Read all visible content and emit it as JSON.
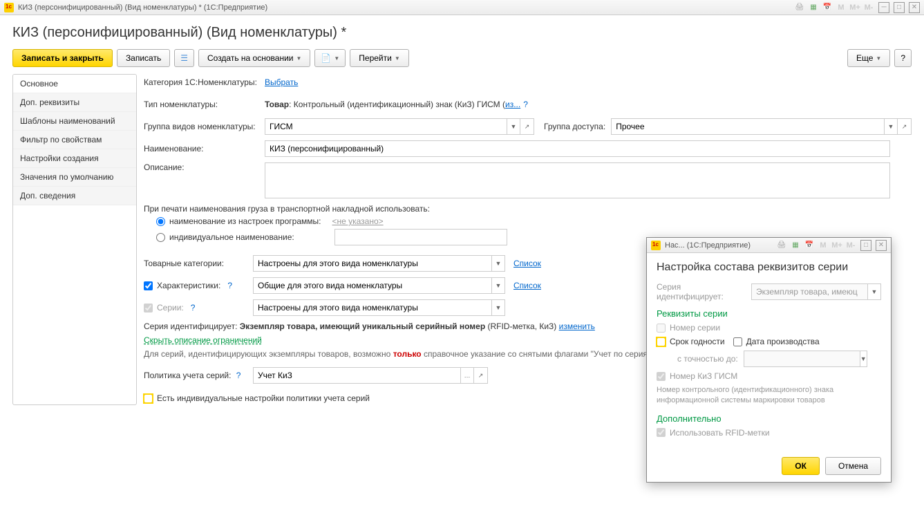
{
  "window": {
    "title": "КИЗ (персонифицированный) (Вид номенклатуры) *   (1С:Предприятие)",
    "m": "M",
    "mplus": "M+",
    "mminus": "M-"
  },
  "page_title": "КИЗ (персонифицированный) (Вид номенклатуры) *",
  "toolbar": {
    "save_close": "Записать и закрыть",
    "save": "Записать",
    "create_based": "Создать на основании",
    "goto": "Перейти",
    "more": "Еще",
    "help": "?"
  },
  "sidebar": {
    "items": [
      "Основное",
      "Доп. реквизиты",
      "Шаблоны наименований",
      "Фильтр по свойствам",
      "Настройки создания",
      "Значения по умолчанию",
      "Доп. сведения"
    ]
  },
  "form": {
    "category_label": "Категория 1С:Номенклатуры:",
    "category_link": "Выбрать",
    "type_label": "Тип номенклатуры:",
    "type_value_bold": "Товар",
    "type_value_rest": ": Контрольный (идентификационный) знак (КиЗ) ГИСМ (",
    "type_change": "из...",
    "type_paren_close": ")",
    "group_kind_label": "Группа видов номенклатуры:",
    "group_kind_value": "ГИСМ",
    "access_group_label": "Группа доступа:",
    "access_group_value": "Прочее",
    "name_label": "Наименование:",
    "name_value": "КИЗ (персонифицированный)",
    "desc_label": "Описание:",
    "desc_value": "",
    "print_label": "При печати наименования груза в транспортной накладной использовать:",
    "radio1": "наименование из настроек программы:",
    "radio1_notset": "<не указано>",
    "radio2": "индивидуальное наименование:",
    "radio2_value": "",
    "tov_cat_label": "Товарные категории:",
    "tov_cat_value": "Настроены для этого вида номенклатуры",
    "list_link": "Список",
    "char_label": "Характеристики:",
    "char_value": "Общие для этого вида номенклатуры",
    "series_label": "Серии:",
    "series_value": "Настроены для этого вида номенклатуры",
    "series_ident_label": "Серия идентифицирует: ",
    "series_ident_bold": "Экземпляр товара, имеющий уникальный серийный номер",
    "series_ident_rest": " (RFID-метка, КиЗ) ",
    "series_change": "изменить",
    "hide_desc": "Скрыть описание ограничений",
    "restriction_text_1": "Для серий, идентифицирующих экземпляры товаров, возможно ",
    "restriction_text_2": "только",
    "restriction_text_3": " справочное указание со снятыми флагами \"Учет по сериям в неотфактурованных поставках товаров\".",
    "policy_label": "Политика учета серий:",
    "policy_value": "Учет КиЗ",
    "indiv_chk": "Есть индивидуальные настройки политики учета серий"
  },
  "modal": {
    "win_title": "Нас...  (1С:Предприятие)",
    "title": "Настройка состава реквизитов серии",
    "ident_label": "Серия идентифицирует:",
    "ident_value": "Экземпляр товара, имеюц",
    "section1": "Реквизиты серии",
    "chk_number": "Номер серии",
    "chk_expiry": "Срок годности",
    "chk_proddate": "Дата производства",
    "precision_label": "с точностью до:",
    "precision_value": "",
    "chk_kiz": "Номер КиЗ ГИСМ",
    "kiz_hint": "Номер контрольного (идентификационного) знака информационной системы маркировки товаров",
    "section2": "Дополнительно",
    "chk_rfid": "Использовать RFID-метки",
    "ok": "ОК",
    "cancel": "Отмена"
  }
}
